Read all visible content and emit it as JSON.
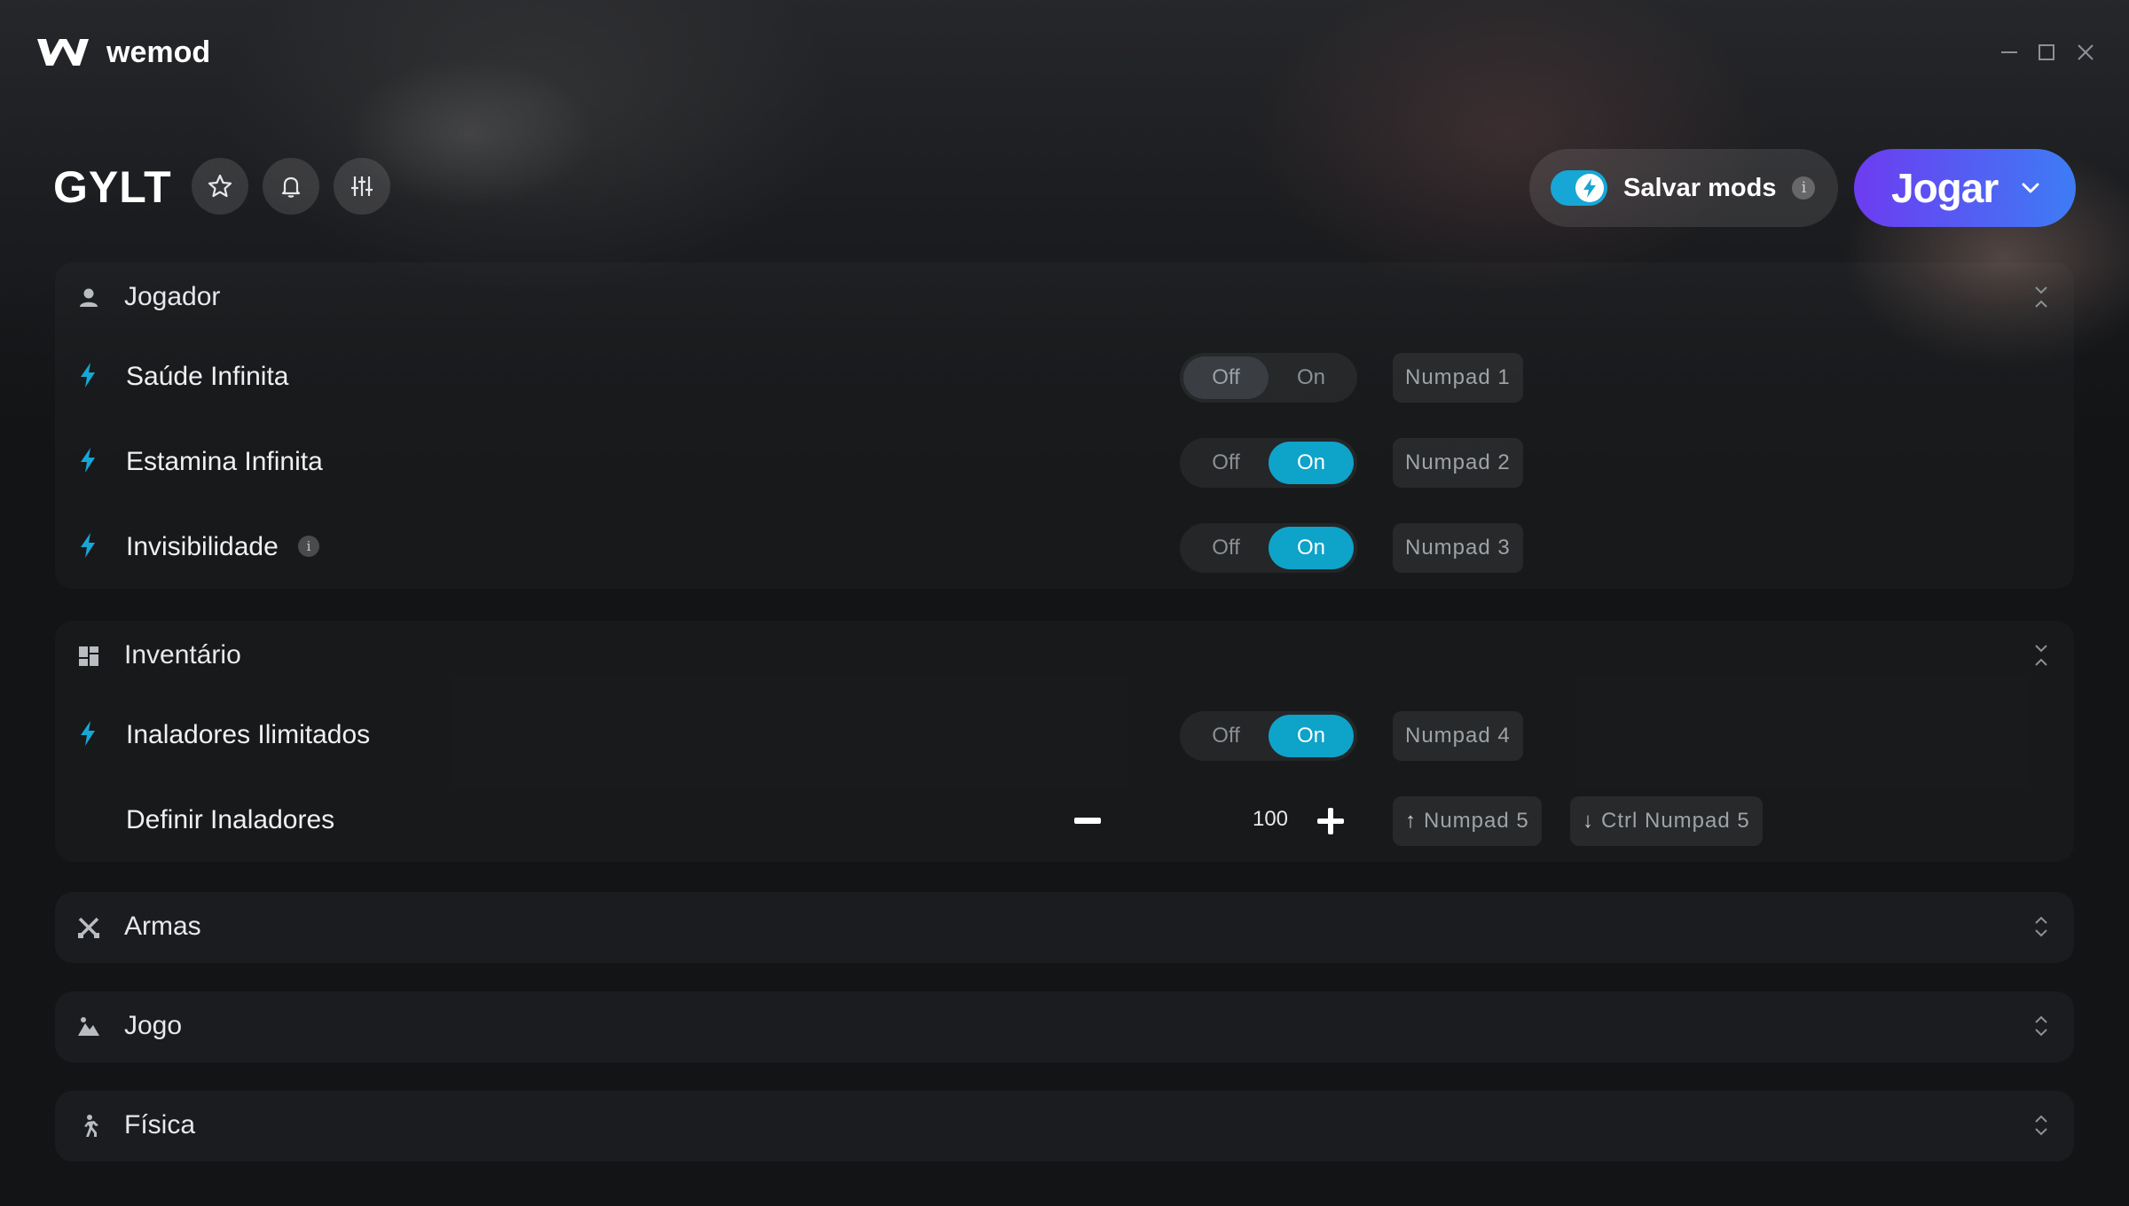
{
  "app": {
    "name": "wemod"
  },
  "window_controls": {
    "minimize": "minimize-icon",
    "maximize": "maximize-icon",
    "close": "close-icon"
  },
  "header": {
    "game_title": "GYLT",
    "icons": [
      "star-icon",
      "bell-icon",
      "sliders-icon"
    ],
    "save_mods": {
      "label": "Salvar mods",
      "info": "i",
      "enabled": true
    },
    "play": {
      "label": "Jogar"
    }
  },
  "colors": {
    "accent": "#0ea3c9",
    "play_start": "#6d3cf0",
    "play_end": "#3d7cf5"
  },
  "sections": [
    {
      "title": "Jogador",
      "icon": "user-icon",
      "expanded": true,
      "rows": [
        {
          "label": "Saúde Infinita",
          "toggle": {
            "off": "Off",
            "on": "On",
            "state": "Off"
          },
          "hotkey": "Numpad 1"
        },
        {
          "label": "Estamina Infinita",
          "toggle": {
            "off": "Off",
            "on": "On",
            "state": "On"
          },
          "hotkey": "Numpad 2"
        },
        {
          "label": "Invisibilidade",
          "info": "i",
          "toggle": {
            "off": "Off",
            "on": "On",
            "state": "On"
          },
          "hotkey": "Numpad 3"
        }
      ]
    },
    {
      "title": "Inventário",
      "icon": "grid-icon",
      "expanded": true,
      "rows": [
        {
          "label": "Inaladores Ilimitados",
          "toggle": {
            "off": "Off",
            "on": "On",
            "state": "On"
          },
          "hotkey": "Numpad 4"
        },
        {
          "label": "Definir Inaladores",
          "value": "100",
          "hotkey_up": "Numpad 5",
          "hotkey_down": "Ctrl Numpad 5"
        }
      ]
    },
    {
      "title": "Armas",
      "icon": "crossed-swords-icon",
      "expanded": false
    },
    {
      "title": "Jogo",
      "icon": "landscape-icon",
      "expanded": false
    },
    {
      "title": "Física",
      "icon": "running-person-icon",
      "expanded": false
    }
  ]
}
